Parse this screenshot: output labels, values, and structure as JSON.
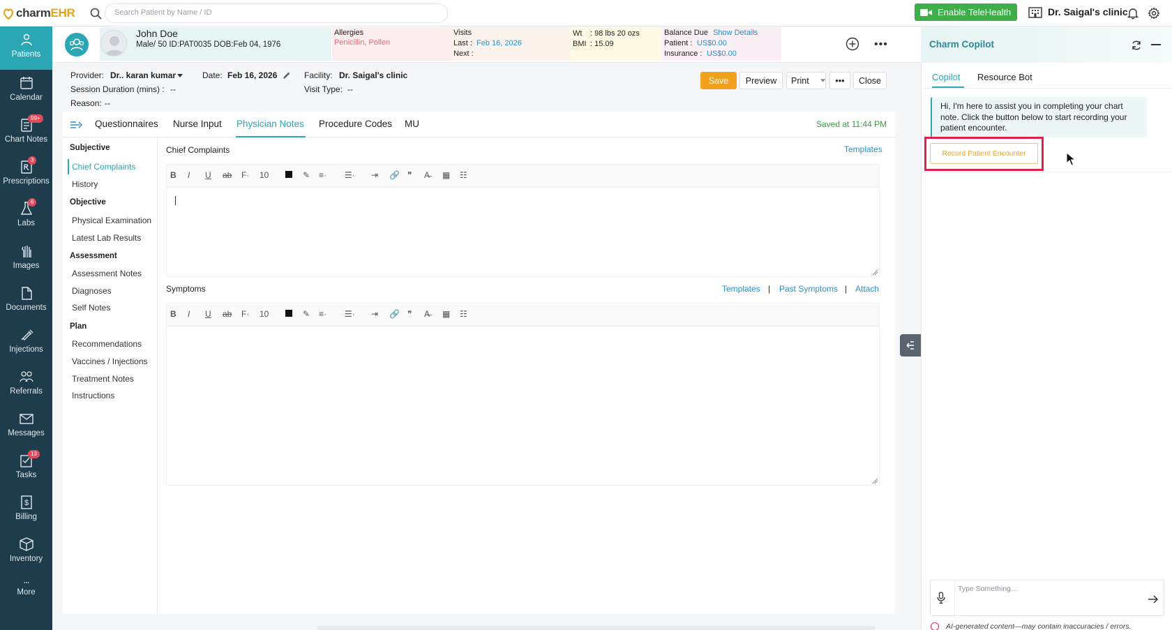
{
  "app": {
    "logo_part1": "charm",
    "logo_part2": "EHR",
    "search_placeholder": "Search Patient by Name / ID",
    "telehealth_label": "Enable TeleHealth",
    "clinic_name": "Dr. Saigal's clinic"
  },
  "nav": [
    {
      "label": "Patients",
      "icon": "patients-icon",
      "active": true
    },
    {
      "label": "Calendar",
      "icon": "calendar-icon"
    },
    {
      "label": "Chart Notes",
      "icon": "chart-notes-icon",
      "badge": "99+"
    },
    {
      "label": "Prescriptions",
      "icon": "prescriptions-icon",
      "badge": "3"
    },
    {
      "label": "Labs",
      "icon": "labs-icon",
      "badge": "6"
    },
    {
      "label": "Images",
      "icon": "images-icon"
    },
    {
      "label": "Documents",
      "icon": "documents-icon"
    },
    {
      "label": "Injections",
      "icon": "injections-icon"
    },
    {
      "label": "Referrals",
      "icon": "referrals-icon"
    },
    {
      "label": "Messages",
      "icon": "messages-icon"
    },
    {
      "label": "Tasks",
      "icon": "tasks-icon",
      "badge": "13"
    },
    {
      "label": "Billing",
      "icon": "billing-icon"
    },
    {
      "label": "Inventory",
      "icon": "inventory-icon"
    },
    {
      "label": "More",
      "icon": "more-icon"
    }
  ],
  "patient": {
    "name": "John Doe",
    "info": "Male/ 50 ID:PAT0035 DOB:Feb 04, 1976",
    "allergies_label": "Allergies",
    "allergies_value": "Penicillin, Pollen",
    "visits_label": "Visits",
    "last_label": "Last  :",
    "last_value": "Feb 16, 2026",
    "next_label": "Next :",
    "wt_label": "Wt",
    "wt_value": ": 98 lbs 20 ozs",
    "bmi_label": "BMI",
    "bmi_value": ": 15.09",
    "balance_label": "Balance Due",
    "show_details": "Show Details",
    "patient_bal_label": "Patient :",
    "patient_bal_value": "US$0.00",
    "insurance_bal_label": "Insurance :",
    "insurance_bal_value": "US$0.00"
  },
  "encounter": {
    "provider_label": "Provider:",
    "provider_value": "Dr.. karan kumar",
    "date_label": "Date:",
    "date_value": "Feb 16, 2026",
    "facility_label": "Facility:",
    "facility_value": "Dr. Saigal's clinic",
    "session_label": "Session Duration (mins) :",
    "session_value": "--",
    "visit_type_label": "Visit Type:",
    "visit_type_value": "--",
    "reason_label": "Reason:",
    "reason_value": "--",
    "save": "Save",
    "preview": "Preview",
    "print": "Print",
    "more": "•••",
    "close": "Close"
  },
  "tabs": [
    "Questionnaires",
    "Nurse Input",
    "Physician Notes",
    "Procedure Codes",
    "MU"
  ],
  "saved_at": "Saved at 11:44 PM",
  "sections": {
    "subjective": "Subjective",
    "chief_complaints": "Chief Complaints",
    "history": "History",
    "objective": "Objective",
    "physical_exam": "Physical Examination",
    "latest_labs": "Latest Lab Results",
    "assessment": "Assessment",
    "assessment_notes": "Assessment Notes",
    "diagnoses": "Diagnoses",
    "self_notes": "Self Notes",
    "plan": "Plan",
    "recommendations": "Recommendations",
    "vaccines": "Vaccines / Injections",
    "treatment_notes": "Treatment Notes",
    "instructions": "Instructions"
  },
  "editor": {
    "chief_title": "Chief Complaints",
    "templates": "Templates",
    "symptoms_title": "Symptoms",
    "past_symptoms": "Past Symptoms",
    "attach": "Attach",
    "sep": "|",
    "font_size": "10"
  },
  "copilot": {
    "title": "Charm Copilot",
    "tab_copilot": "Copilot",
    "tab_resource": "Resource Bot",
    "message": "Hi, I'm here to assist you in completing your chart note. Click the button below to start recording your patient encounter.",
    "record_button": "Record Patient Encounter",
    "input_placeholder": "Type Something...",
    "disclaimer": "AI-generated content—may contain inaccuracies / errors."
  },
  "colors": {
    "accent": "#2aa6b4",
    "sidebar": "#1f3c4c",
    "save": "#f2a21e",
    "telehealth": "#3fae49",
    "highlight": "#e0204a"
  }
}
